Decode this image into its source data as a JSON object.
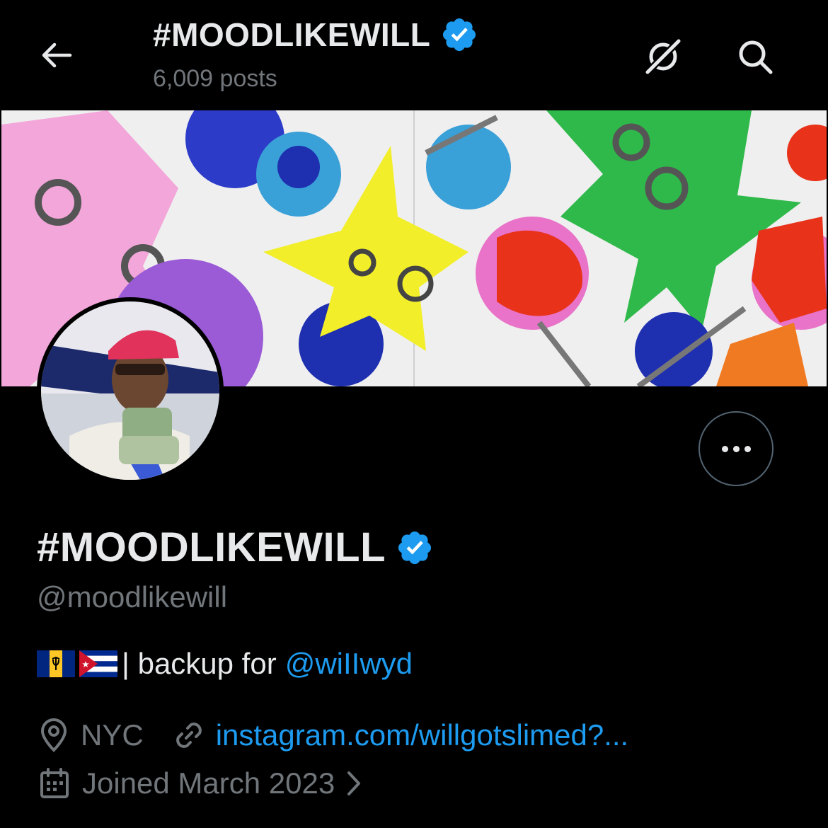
{
  "header": {
    "title": "#MOODLIKEWILL",
    "post_count": "6,009 posts",
    "back_icon": "arrow-left-icon",
    "grok_icon": "grok-icon",
    "search_icon": "search-icon"
  },
  "profile": {
    "display_name": "#MOODLIKEWILL",
    "verified": true,
    "handle": "@moodlikewill",
    "bio": {
      "flags": [
        "barbados-flag",
        "cuba-flag"
      ],
      "text": "| backup for",
      "mention": "@wiIIwyd"
    },
    "location": "NYC",
    "website": "instagram.com/willgotslimed?...",
    "joined": "Joined March 2023"
  },
  "colors": {
    "background": "#000000",
    "accent": "#1d9bf0",
    "text_primary": "#e7e9ea",
    "text_secondary": "#71767b"
  }
}
